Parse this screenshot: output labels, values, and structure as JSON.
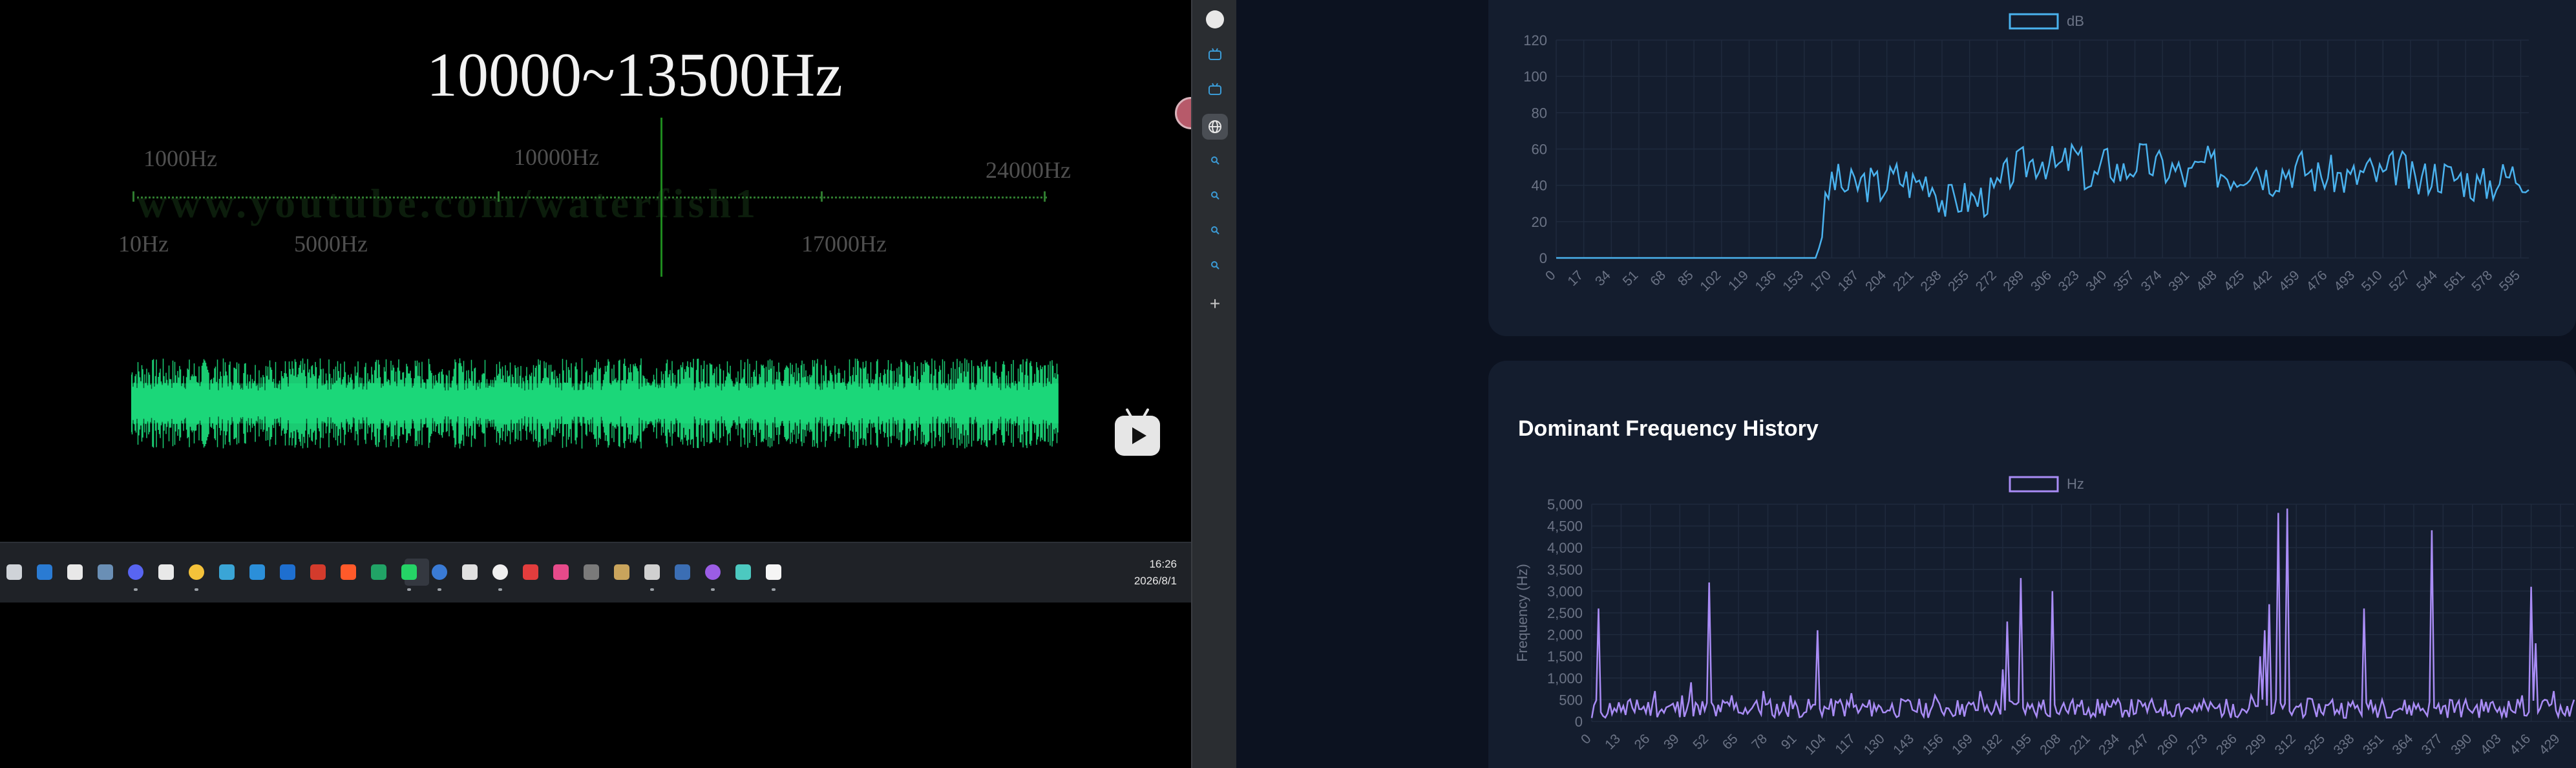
{
  "video": {
    "title": "10000~13500Hz",
    "scale_labels": {
      "l1000": "1000Hz",
      "l10000": "10000Hz",
      "l24000": "24000Hz",
      "l10": "10Hz",
      "l5000": "5000Hz",
      "l17000": "17000Hz"
    },
    "watermark": "www.youtube.com/waterfish1",
    "play_icon": "bilibili-tv-icon"
  },
  "taskbar": {
    "time": "16:26",
    "date": "2026/8/1",
    "icons": [
      "file-explorer-icon",
      "edge-icon",
      "notepad-icon",
      "calculator-icon",
      "discord-icon",
      "wechat-icon",
      "folder-icon",
      "spreadsheet-icon",
      "mail-icon",
      "outlook-icon",
      "office-icon",
      "app-red-icon",
      "excel-icon",
      "whatsapp-icon",
      "chrome-icon",
      "media-player-icon",
      "chat-icon",
      "xmind-icon",
      "app-pink-icon",
      "camera-icon",
      "photos-icon",
      "screenshot-icon",
      "steam-icon",
      "app-purple-icon",
      "terminal-icon",
      "app-white-icon"
    ]
  },
  "sidebar_strip": {
    "items": [
      "chatgpt-icon",
      "bilibili-icon",
      "bilibili-icon",
      "globe-icon",
      "search-icon",
      "search-icon",
      "search-icon",
      "search-icon",
      "add-icon"
    ]
  },
  "colors": {
    "background": "#0c1220",
    "card": "#141d2e",
    "db_line": "#4ab2ee",
    "hz_line": "#a98cf5",
    "wave": "#1fef86",
    "grid": "#1f2a3d",
    "tick_text": "#6b7385"
  },
  "chart_data": [
    {
      "type": "line",
      "title": "",
      "legend": "dB",
      "legend_position": "top-center",
      "xlabel": "",
      "ylabel": "",
      "ylim": [
        0,
        120
      ],
      "yticks": [
        0,
        20,
        40,
        60,
        80,
        100,
        120
      ],
      "xticks": [
        "0",
        "17",
        "34",
        "51",
        "68",
        "85",
        "102",
        "119",
        "136",
        "153",
        "170",
        "187",
        "204",
        "221",
        "238",
        "255",
        "272",
        "289",
        "306",
        "323",
        "340",
        "357",
        "374",
        "391",
        "408",
        "425",
        "442",
        "459",
        "476",
        "493",
        "510",
        "527",
        "544",
        "561",
        "578",
        "595"
      ],
      "x_max": 600,
      "series": [
        {
          "name": "dB",
          "sampled_every": 10,
          "values": [
            0,
            0,
            0,
            0,
            0,
            0,
            0,
            0,
            0,
            0,
            0,
            0,
            0,
            0,
            0,
            0,
            0,
            44,
            38,
            42,
            39,
            45,
            41,
            44,
            30,
            33,
            32,
            35,
            47,
            52,
            55,
            49,
            57,
            41,
            53,
            47,
            55,
            50,
            49,
            44,
            52,
            48,
            46,
            53,
            44,
            49,
            50,
            45,
            46,
            43,
            48,
            44,
            52,
            40,
            47,
            45,
            44,
            39,
            43,
            46
          ]
        }
      ],
      "grid": true
    },
    {
      "type": "line",
      "title": "Dominant Frequency History",
      "legend": "Hz",
      "legend_position": "top-center",
      "xlabel": "",
      "ylabel": "Frequency (Hz)",
      "ylim": [
        0,
        5000
      ],
      "yticks": [
        "0",
        "500",
        "1,000",
        "1,500",
        "2,000",
        "2,500",
        "3,000",
        "3,500",
        "4,000",
        "4,500",
        "5,000"
      ],
      "xticks": [
        "0",
        "13",
        "26",
        "39",
        "52",
        "65",
        "78",
        "91",
        "104",
        "117",
        "130",
        "143",
        "156",
        "169",
        "182",
        "195",
        "208",
        "221",
        "234",
        "247",
        "260",
        "273",
        "286",
        "299",
        "312",
        "325",
        "338",
        "351",
        "364",
        "377",
        "390",
        "403",
        "416",
        "429"
      ],
      "x_max": 435,
      "series": [
        {
          "name": "Hz",
          "points": [
            [
              0,
              80
            ],
            [
              3,
              2600
            ],
            [
              6,
              90
            ],
            [
              10,
              300
            ],
            [
              15,
              150
            ],
            [
              20,
              500
            ],
            [
              28,
              700
            ],
            [
              32,
              200
            ],
            [
              40,
              600
            ],
            [
              44,
              900
            ],
            [
              48,
              150
            ],
            [
              52,
              3200
            ],
            [
              55,
              120
            ],
            [
              62,
              600
            ],
            [
              66,
              200
            ],
            [
              72,
              400
            ],
            [
              76,
              700
            ],
            [
              80,
              150
            ],
            [
              88,
              600
            ],
            [
              94,
              200
            ],
            [
              100,
              2100
            ],
            [
              104,
              300
            ],
            [
              110,
              500
            ],
            [
              115,
              650
            ],
            [
              118,
              200
            ],
            [
              125,
              400
            ],
            [
              132,
              250
            ],
            [
              140,
              500
            ],
            [
              146,
              200
            ],
            [
              152,
              600
            ],
            [
              158,
              300
            ],
            [
              164,
              400
            ],
            [
              172,
              700
            ],
            [
              178,
              250
            ],
            [
              182,
              1200
            ],
            [
              184,
              2300
            ],
            [
              187,
              400
            ],
            [
              190,
              3300
            ],
            [
              194,
              300
            ],
            [
              200,
              500
            ],
            [
              204,
              3000
            ],
            [
              206,
              200
            ],
            [
              212,
              400
            ],
            [
              220,
              300
            ],
            [
              228,
              450
            ],
            [
              236,
              250
            ],
            [
              244,
              350
            ],
            [
              252,
              300
            ],
            [
              260,
              400
            ],
            [
              268,
              250
            ],
            [
              276,
              300
            ],
            [
              284,
              400
            ],
            [
              292,
              600
            ],
            [
              296,
              1500
            ],
            [
              298,
              2100
            ],
            [
              300,
              2700
            ],
            [
              302,
              200
            ],
            [
              304,
              4800
            ],
            [
              306,
              300
            ],
            [
              308,
              4900
            ],
            [
              310,
              150
            ],
            [
              314,
              400
            ],
            [
              320,
              300
            ],
            [
              328,
              500
            ],
            [
              336,
              350
            ],
            [
              342,
              2600
            ],
            [
              344,
              300
            ],
            [
              350,
              500
            ],
            [
              358,
              300
            ],
            [
              366,
              400
            ],
            [
              372,
              4400
            ],
            [
              374,
              300
            ],
            [
              380,
              500
            ],
            [
              388,
              300
            ],
            [
              396,
              450
            ],
            [
              404,
              300
            ],
            [
              412,
              600
            ],
            [
              416,
              3100
            ],
            [
              418,
              1800
            ],
            [
              420,
              300
            ],
            [
              426,
              700
            ],
            [
              430,
              200
            ],
            [
              435,
              500
            ]
          ]
        }
      ],
      "grid": true
    }
  ]
}
